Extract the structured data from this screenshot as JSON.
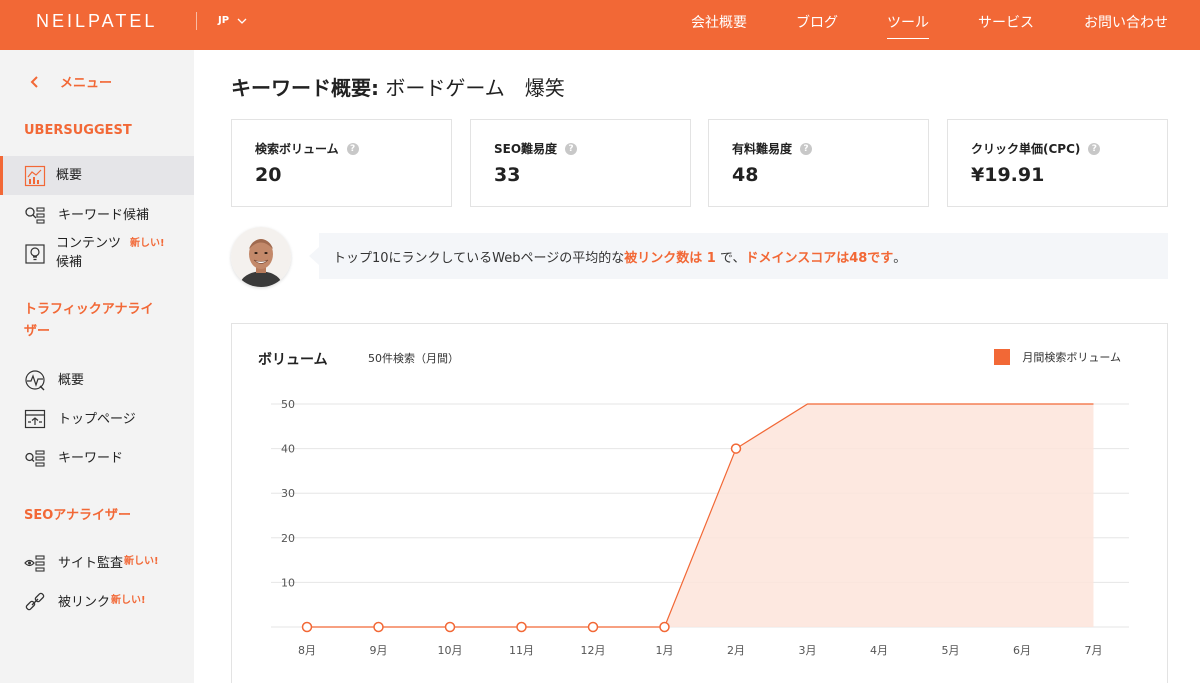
{
  "header": {
    "logo": "NEILPATEL",
    "lang": "JP",
    "nav": [
      {
        "label": "会社概要",
        "active": false
      },
      {
        "label": "ブログ",
        "active": false
      },
      {
        "label": "ツール",
        "active": true
      },
      {
        "label": "サービス",
        "active": false
      },
      {
        "label": "お問い合わせ",
        "active": false
      }
    ]
  },
  "sidebar": {
    "menu_label": "メニュー",
    "ubersuggest": {
      "heading": "UBERSUGGEST",
      "items": [
        {
          "label": "概要",
          "icon": "chart-icon",
          "active": true
        },
        {
          "label": "キーワード候補",
          "icon": "keyword-list-icon"
        },
        {
          "label": "コンテンツ\n候補",
          "icon": "bulb-icon",
          "badge": "新しい!"
        }
      ]
    },
    "traffic": {
      "heading": "トラフィックアナライ\nザー",
      "items": [
        {
          "label": "概要",
          "icon": "pulse-icon"
        },
        {
          "label": "トップページ",
          "icon": "page-icon"
        },
        {
          "label": "キーワード",
          "icon": "keyword-search-icon"
        }
      ]
    },
    "seo": {
      "heading": "SEOアナライザー",
      "items": [
        {
          "label": "サイト監査",
          "icon": "eye-list-icon",
          "badge": "新しい!"
        },
        {
          "label": "被リンク",
          "icon": "link-icon",
          "badge": "新しい!"
        }
      ]
    }
  },
  "main": {
    "title_prefix": "キーワード概要:",
    "title_keyword": " ボードゲーム　爆笑",
    "stats": [
      {
        "label": "検索ボリューム",
        "value": "20"
      },
      {
        "label": "SEO難易度",
        "value": "33"
      },
      {
        "label": "有料難易度",
        "value": "48"
      },
      {
        "label": "クリック単価(CPC)",
        "value": "¥19.91"
      }
    ],
    "help_glyph": "?",
    "tip": {
      "part1": "トップ10にランクしているWebページの平均的な",
      "hl1": "被リンク数は 1",
      "part2": "で、",
      "hl2": "ドメインスコアは48です",
      "part3": "。"
    },
    "volume_chart": {
      "title": "ボリューム",
      "subtitle": "50件検索（月間）",
      "legend": "月間検索ボリューム"
    }
  },
  "colors": {
    "accent": "#f26836",
    "area_fill": "#fde4da"
  },
  "chart_data": {
    "type": "area",
    "categories": [
      "8月",
      "9月",
      "10月",
      "11月",
      "12月",
      "1月",
      "2月",
      "3月",
      "4月",
      "5月",
      "6月",
      "7月"
    ],
    "series": [
      {
        "name": "月間検索ボリューム",
        "values": [
          0,
          0,
          0,
          0,
          0,
          0,
          40,
          50,
          50,
          50,
          50,
          50
        ]
      }
    ],
    "markers_on": [
      0,
      1,
      2,
      3,
      4,
      5,
      6
    ],
    "yticks": [
      10,
      20,
      30,
      40,
      50
    ],
    "ylim": [
      0,
      50
    ],
    "title": "ボリューム",
    "legend_position": "top-right",
    "grid": true
  }
}
